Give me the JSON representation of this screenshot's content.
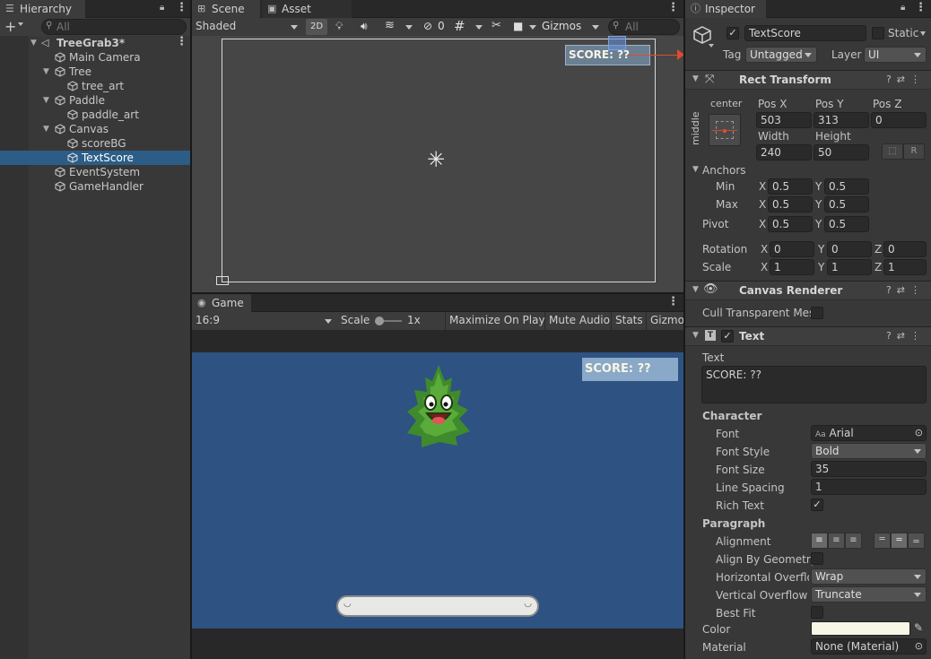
{
  "hierarchy": {
    "tab": "Hierarchy",
    "search_placeholder": "All",
    "scene": "TreeGrab3*",
    "items": [
      {
        "label": "Main Camera"
      },
      {
        "label": "Tree"
      },
      {
        "label": "tree_art"
      },
      {
        "label": "Paddle"
      },
      {
        "label": "paddle_art"
      },
      {
        "label": "Canvas"
      },
      {
        "label": "scoreBG"
      },
      {
        "label": "TextScore"
      },
      {
        "label": "EventSystem"
      },
      {
        "label": "GameHandler"
      }
    ]
  },
  "scene_view": {
    "tabs": [
      "Scene",
      "Asset Store"
    ],
    "shading": "Shaded",
    "mode_2d": "2D",
    "hidden_count": "0",
    "gizmos": "Gizmos",
    "search_placeholder": "All",
    "canvas_text": "SCORE: ??"
  },
  "game_view": {
    "tab": "Game",
    "aspect": "16:9",
    "scale_label": "Scale",
    "scale_value": "1x",
    "maximize": "Maximize On Play",
    "mute": "Mute Audio",
    "stats": "Stats",
    "gizmos": "Gizmos",
    "score_text": "SCORE: ??",
    "background_color": "#2e5282"
  },
  "inspector": {
    "tab": "Inspector",
    "object_name": "TextScore",
    "static_label": "Static",
    "tag_label": "Tag",
    "tag_value": "Untagged",
    "layer_label": "Layer",
    "layer_value": "UI",
    "rect_transform": {
      "title": "Rect Transform",
      "anchor_h": "center",
      "anchor_v": "middle",
      "pos_x_label": "Pos X",
      "pos_x": "503",
      "pos_y_label": "Pos Y",
      "pos_y": "313",
      "pos_z_label": "Pos Z",
      "pos_z": "0",
      "width_label": "Width",
      "width": "240",
      "height_label": "Height",
      "height": "50",
      "r_button": "R",
      "anchors_label": "Anchors",
      "min_label": "Min",
      "min_x": "0.5",
      "min_y": "0.5",
      "max_label": "Max",
      "max_x": "0.5",
      "max_y": "0.5",
      "pivot_label": "Pivot",
      "pivot_x": "0.5",
      "pivot_y": "0.5",
      "rotation_label": "Rotation",
      "rot_x": "0",
      "rot_y": "0",
      "rot_z": "0",
      "scale_label": "Scale",
      "scale_x": "1",
      "scale_y": "1",
      "scale_z": "1",
      "x": "X",
      "y": "Y",
      "z": "Z"
    },
    "canvas_renderer": {
      "title": "Canvas Renderer",
      "cull_label": "Cull Transparent Mes"
    },
    "text": {
      "title": "Text",
      "text_label": "Text",
      "text_value": "SCORE: ??",
      "character_label": "Character",
      "font_label": "Font",
      "font_value": "Arial",
      "font_prefix": "Aa",
      "font_style_label": "Font Style",
      "font_style_value": "Bold",
      "font_size_label": "Font Size",
      "font_size_value": "35",
      "line_spacing_label": "Line Spacing",
      "line_spacing_value": "1",
      "rich_text_label": "Rich Text",
      "paragraph_label": "Paragraph",
      "alignment_label": "Alignment",
      "align_geom_label": "Align By Geometry",
      "h_overflow_label": "Horizontal Overflow",
      "h_overflow_value": "Wrap",
      "v_overflow_label": "Vertical Overflow",
      "v_overflow_value": "Truncate",
      "best_fit_label": "Best Fit",
      "color_label": "Color",
      "color_value": "#f8f6e4",
      "material_label": "Material",
      "material_value": "None (Material)"
    }
  }
}
